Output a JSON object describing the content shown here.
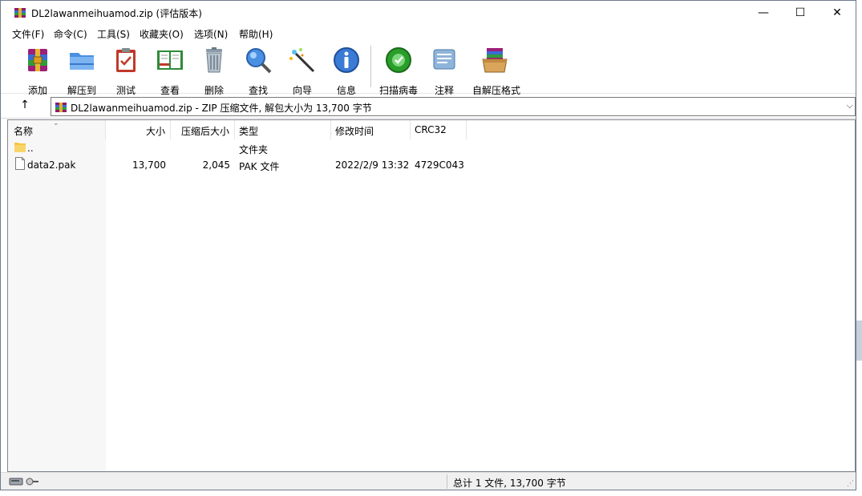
{
  "window": {
    "title": "DL2lawanmeihuamod.zip (评估版本)",
    "minimize": "—",
    "maximize": "☐",
    "close": "✕"
  },
  "menu": [
    "文件(F)",
    "命令(C)",
    "工具(S)",
    "收藏夹(O)",
    "选项(N)",
    "帮助(H)"
  ],
  "toolbar": [
    {
      "label": "添加",
      "icon": "winrar-add-icon"
    },
    {
      "label": "解压到",
      "icon": "folder-extract-icon"
    },
    {
      "label": "测试",
      "icon": "clipboard-test-icon"
    },
    {
      "label": "查看",
      "icon": "book-view-icon"
    },
    {
      "label": "删除",
      "icon": "trash-icon"
    },
    {
      "label": "查找",
      "icon": "magnifier-icon"
    },
    {
      "label": "向导",
      "icon": "magic-wand-icon"
    },
    {
      "label": "信息",
      "icon": "info-icon"
    },
    {
      "label": "扫描病毒",
      "icon": "virus-scan-icon"
    },
    {
      "label": "注释",
      "icon": "comment-icon"
    },
    {
      "label": "自解压格式",
      "icon": "sfx-box-icon"
    }
  ],
  "address": {
    "up": "↑",
    "path": "DL2lawanmeihuamod.zip - ZIP 压缩文件, 解包大小为 13,700 字节",
    "dropdown": "⌵"
  },
  "columns": {
    "name": "名称",
    "size": "大小",
    "packed": "压缩后大小",
    "type": "类型",
    "modified": "修改时间",
    "crc": "CRC32",
    "sort_indicator": "⌄"
  },
  "rows": [
    {
      "name": "..",
      "size": "",
      "packed": "",
      "type": "文件夹",
      "modified": "",
      "crc": ""
    },
    {
      "name": "data2.pak",
      "size": "13,700",
      "packed": "2,045",
      "type": "PAK 文件",
      "modified": "2022/2/9 13:32",
      "crc": "4729C043"
    }
  ],
  "status": {
    "summary": "总计 1 文件, 13,700 字节"
  },
  "colors": {
    "accent_blue": "#1e6fd9",
    "green_scan": "#2a9d2a",
    "folder_yellow": "#f5c542"
  }
}
